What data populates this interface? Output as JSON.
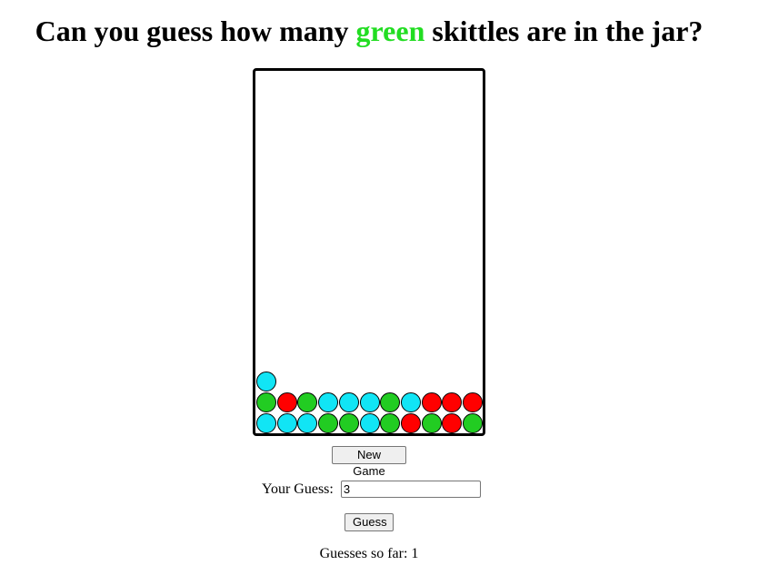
{
  "header": {
    "title_prefix": "Can you guess how many ",
    "title_highlight": "green",
    "title_suffix": " skittles are in the jar?",
    "highlight_color": "#22dd22"
  },
  "jar": {
    "skittles": [
      {
        "color": "cyan"
      },
      {
        "color": "green"
      },
      {
        "color": "red"
      },
      {
        "color": "green"
      },
      {
        "color": "cyan"
      },
      {
        "color": "cyan"
      },
      {
        "color": "cyan"
      },
      {
        "color": "green"
      },
      {
        "color": "cyan"
      },
      {
        "color": "red"
      },
      {
        "color": "red"
      },
      {
        "color": "red"
      },
      {
        "color": "cyan"
      },
      {
        "color": "cyan"
      },
      {
        "color": "cyan"
      },
      {
        "color": "green"
      },
      {
        "color": "green"
      },
      {
        "color": "cyan"
      },
      {
        "color": "green"
      },
      {
        "color": "red"
      },
      {
        "color": "green"
      },
      {
        "color": "red"
      },
      {
        "color": "green"
      }
    ],
    "palette": {
      "cyan": "#11e5f5",
      "green": "#22cc22",
      "red": "#ff0000"
    }
  },
  "controls": {
    "new_game_label": "New Game",
    "guess_label": "Your Guess:",
    "guess_value": "3",
    "guess_button_label": "Guess"
  },
  "status": {
    "guesses_text": "Guesses so far: 1"
  }
}
